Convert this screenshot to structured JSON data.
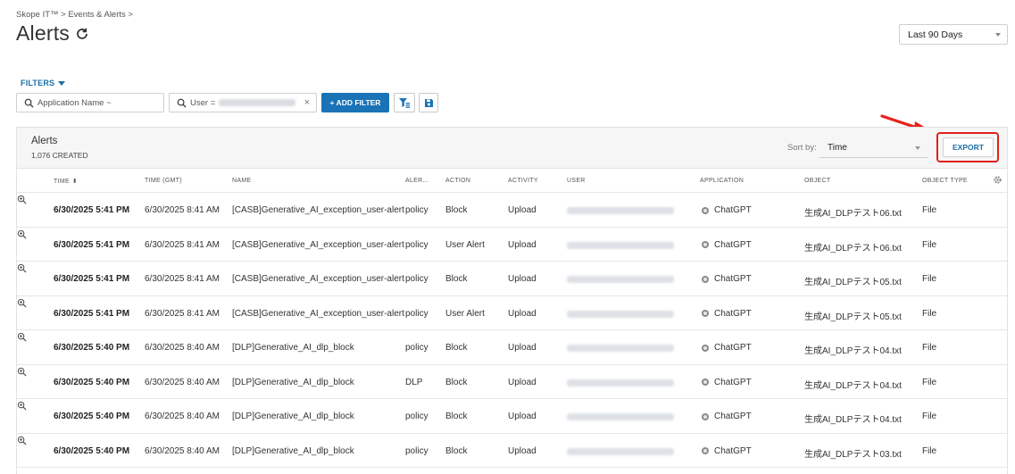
{
  "breadcrumb": "Skope IT™ > Events & Alerts >",
  "page": {
    "title": "Alerts"
  },
  "date_range": {
    "selected": "Last 90 Days"
  },
  "filters": {
    "label": "FILTERS",
    "application_placeholder": "Application Name ~",
    "user_prefix": "User =",
    "add_filter_label": "+ ADD FILTER"
  },
  "panel": {
    "title": "Alerts",
    "count": "1,076 CREATED",
    "sort_label": "Sort by:",
    "sort_value": "Time",
    "export_label": "EXPORT"
  },
  "columns": {
    "time": "TIME",
    "time_gmt": "TIME (GMT)",
    "name": "NAME",
    "alert": "ALER...",
    "action": "ACTION",
    "activity": "ACTIVITY",
    "user": "USER",
    "application": "APPLICATION",
    "object": "OBJECT",
    "object_type": "OBJECT TYPE"
  },
  "rows": [
    {
      "time": "6/30/2025 5:41 PM",
      "time_gmt": "6/30/2025 8:41 AM",
      "name": "[CASB]Generative_AI_exception_user-alert",
      "alert": "policy",
      "action": "Block",
      "activity": "Upload",
      "application": "ChatGPT",
      "object": "生成AI_DLPテスト06.txt",
      "object_type": "File"
    },
    {
      "time": "6/30/2025 5:41 PM",
      "time_gmt": "6/30/2025 8:41 AM",
      "name": "[CASB]Generative_AI_exception_user-alert",
      "alert": "policy",
      "action": "User Alert",
      "activity": "Upload",
      "application": "ChatGPT",
      "object": "生成AI_DLPテスト06.txt",
      "object_type": "File"
    },
    {
      "time": "6/30/2025 5:41 PM",
      "time_gmt": "6/30/2025 8:41 AM",
      "name": "[CASB]Generative_AI_exception_user-alert",
      "alert": "policy",
      "action": "Block",
      "activity": "Upload",
      "application": "ChatGPT",
      "object": "生成AI_DLPテスト05.txt",
      "object_type": "File"
    },
    {
      "time": "6/30/2025 5:41 PM",
      "time_gmt": "6/30/2025 8:41 AM",
      "name": "[CASB]Generative_AI_exception_user-alert",
      "alert": "policy",
      "action": "User Alert",
      "activity": "Upload",
      "application": "ChatGPT",
      "object": "生成AI_DLPテスト05.txt",
      "object_type": "File"
    },
    {
      "time": "6/30/2025 5:40 PM",
      "time_gmt": "6/30/2025 8:40 AM",
      "name": "[DLP]Generative_AI_dlp_block",
      "alert": "policy",
      "action": "Block",
      "activity": "Upload",
      "application": "ChatGPT",
      "object": "生成AI_DLPテスト04.txt",
      "object_type": "File"
    },
    {
      "time": "6/30/2025 5:40 PM",
      "time_gmt": "6/30/2025 8:40 AM",
      "name": "[DLP]Generative_AI_dlp_block",
      "alert": "DLP",
      "action": "Block",
      "activity": "Upload",
      "application": "ChatGPT",
      "object": "生成AI_DLPテスト04.txt",
      "object_type": "File"
    },
    {
      "time": "6/30/2025 5:40 PM",
      "time_gmt": "6/30/2025 8:40 AM",
      "name": "[DLP]Generative_AI_dlp_block",
      "alert": "policy",
      "action": "Block",
      "activity": "Upload",
      "application": "ChatGPT",
      "object": "生成AI_DLPテスト04.txt",
      "object_type": "File"
    },
    {
      "time": "6/30/2025 5:40 PM",
      "time_gmt": "6/30/2025 8:40 AM",
      "name": "[DLP]Generative_AI_dlp_block",
      "alert": "policy",
      "action": "Block",
      "activity": "Upload",
      "application": "ChatGPT",
      "object": "生成AI_DLPテスト03.txt",
      "object_type": "File"
    }
  ],
  "colors": {
    "accent": "#1a73b6",
    "highlight": "#e0201a"
  },
  "icons": [
    "refresh-icon",
    "search-icon",
    "filter-clear-icon",
    "save-icon",
    "gear-icon",
    "zoom-icon",
    "app-icon"
  ]
}
